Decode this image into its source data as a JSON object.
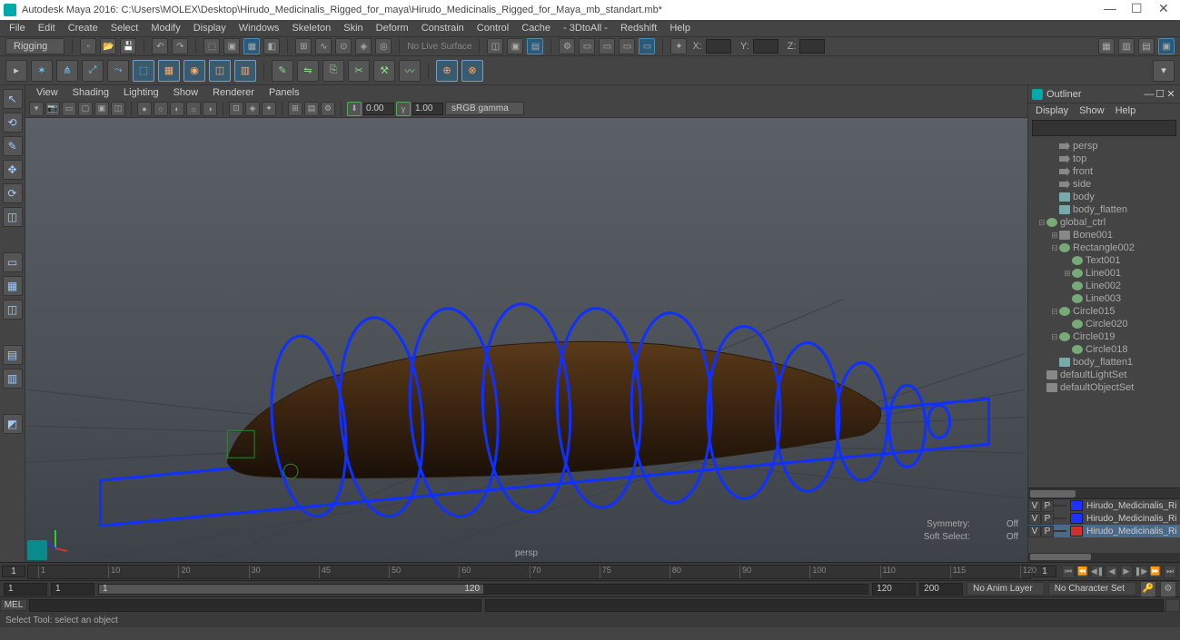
{
  "title": "Autodesk Maya 2016: C:\\Users\\MOLEX\\Desktop\\Hirudo_Medicinalis_Rigged_for_maya\\Hirudo_Medicinalis_Rigged_for_Maya_mb_standart.mb*",
  "menubar": [
    "File",
    "Edit",
    "Create",
    "Select",
    "Modify",
    "Display",
    "Windows",
    "Skeleton",
    "Skin",
    "Deform",
    "Constrain",
    "Control",
    "Cache",
    "- 3DtoAll -",
    "Redshift",
    "Help"
  ],
  "shelf": {
    "mode": "Rigging",
    "status": "No Live Surface",
    "coords": [
      "X:",
      "Y:",
      "Z:"
    ]
  },
  "viewmenu": [
    "View",
    "Shading",
    "Lighting",
    "Show",
    "Renderer",
    "Panels"
  ],
  "viewtoolbar": {
    "gamma": "sRGB gamma",
    "exp1": "0.00",
    "exp2": "1.00"
  },
  "viewport": {
    "camera": "persp",
    "sym_label": "Symmetry:",
    "sym_val": "Off",
    "soft_label": "Soft Select:",
    "soft_val": "Off"
  },
  "outliner": {
    "title": "Outliner",
    "menu": [
      "Display",
      "Show",
      "Help"
    ],
    "items": [
      {
        "indent": 1,
        "icon": "cam",
        "label": "persp",
        "exp": ""
      },
      {
        "indent": 1,
        "icon": "cam",
        "label": "top",
        "exp": ""
      },
      {
        "indent": 1,
        "icon": "cam",
        "label": "front",
        "exp": ""
      },
      {
        "indent": 1,
        "icon": "cam",
        "label": "side",
        "exp": ""
      },
      {
        "indent": 1,
        "icon": "mesh",
        "label": "body",
        "exp": ""
      },
      {
        "indent": 1,
        "icon": "mesh",
        "label": "body_flatten",
        "exp": ""
      },
      {
        "indent": 0,
        "icon": "curve",
        "label": "global_ctrl",
        "exp": "⊟"
      },
      {
        "indent": 1,
        "icon": "grp",
        "label": "Bone001",
        "exp": "⊞"
      },
      {
        "indent": 1,
        "icon": "curve",
        "label": "Rectangle002",
        "exp": "⊟"
      },
      {
        "indent": 2,
        "icon": "curve",
        "label": "Text001",
        "exp": ""
      },
      {
        "indent": 2,
        "icon": "curve",
        "label": "Line001",
        "exp": "⊞"
      },
      {
        "indent": 2,
        "icon": "curve",
        "label": "Line002",
        "exp": ""
      },
      {
        "indent": 2,
        "icon": "curve",
        "label": "Line003",
        "exp": ""
      },
      {
        "indent": 1,
        "icon": "curve",
        "label": "Circle015",
        "exp": "⊟"
      },
      {
        "indent": 2,
        "icon": "curve",
        "label": "Circle020",
        "exp": ""
      },
      {
        "indent": 1,
        "icon": "curve",
        "label": "Circle019",
        "exp": "⊟"
      },
      {
        "indent": 2,
        "icon": "curve",
        "label": "Circle018",
        "exp": ""
      },
      {
        "indent": 1,
        "icon": "mesh",
        "label": "body_flatten1",
        "exp": ""
      },
      {
        "indent": 0,
        "icon": "grp",
        "label": "defaultLightSet",
        "exp": ""
      },
      {
        "indent": 0,
        "icon": "grp",
        "label": "defaultObjectSet",
        "exp": ""
      }
    ]
  },
  "layers": [
    {
      "v": "V",
      "p": "P",
      "color": "#2030ff",
      "name": "Hirudo_Medicinalis_Ri",
      "sel": false
    },
    {
      "v": "V",
      "p": "P",
      "color": "#2030ff",
      "name": "Hirudo_Medicinalis_Ri",
      "sel": false
    },
    {
      "v": "V",
      "p": "P",
      "color": "#d03030",
      "name": "Hirudo_Medicinalis_Ri",
      "sel": true
    }
  ],
  "timeline": {
    "start": "1",
    "end": "1",
    "ticks": [
      "1",
      "10",
      "20",
      "30",
      "45",
      "50",
      "60",
      "70",
      "75",
      "80",
      "90",
      "100",
      "110",
      "115",
      "120"
    ]
  },
  "range": {
    "f1": "1",
    "f2": "1",
    "rstart": "1",
    "rend": "120",
    "f3": "120",
    "f4": "200",
    "animlayer": "No Anim Layer",
    "charset": "No Character Set"
  },
  "cmd": {
    "label": "MEL"
  },
  "help": "Select Tool: select an object"
}
